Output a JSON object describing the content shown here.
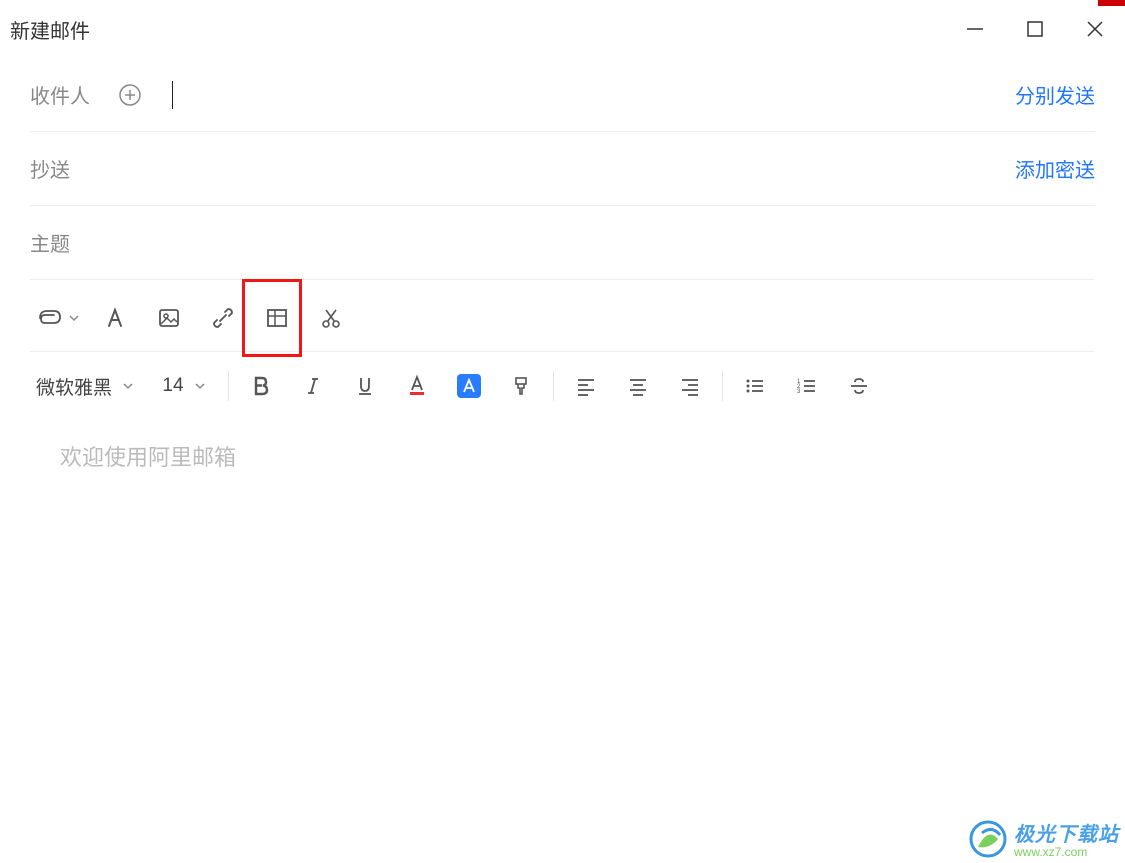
{
  "window": {
    "title": "新建邮件"
  },
  "fields": {
    "recipient_label": "收件人",
    "cc_label": "抄送",
    "subject_label": "主题",
    "send_separately": "分别发送",
    "add_bcc": "添加密送"
  },
  "format": {
    "font_name": "微软雅黑",
    "font_size": "14"
  },
  "editor": {
    "placeholder": "欢迎使用阿里邮箱"
  },
  "watermark": {
    "name": "极光下载站",
    "url": "www.xz7.com"
  }
}
